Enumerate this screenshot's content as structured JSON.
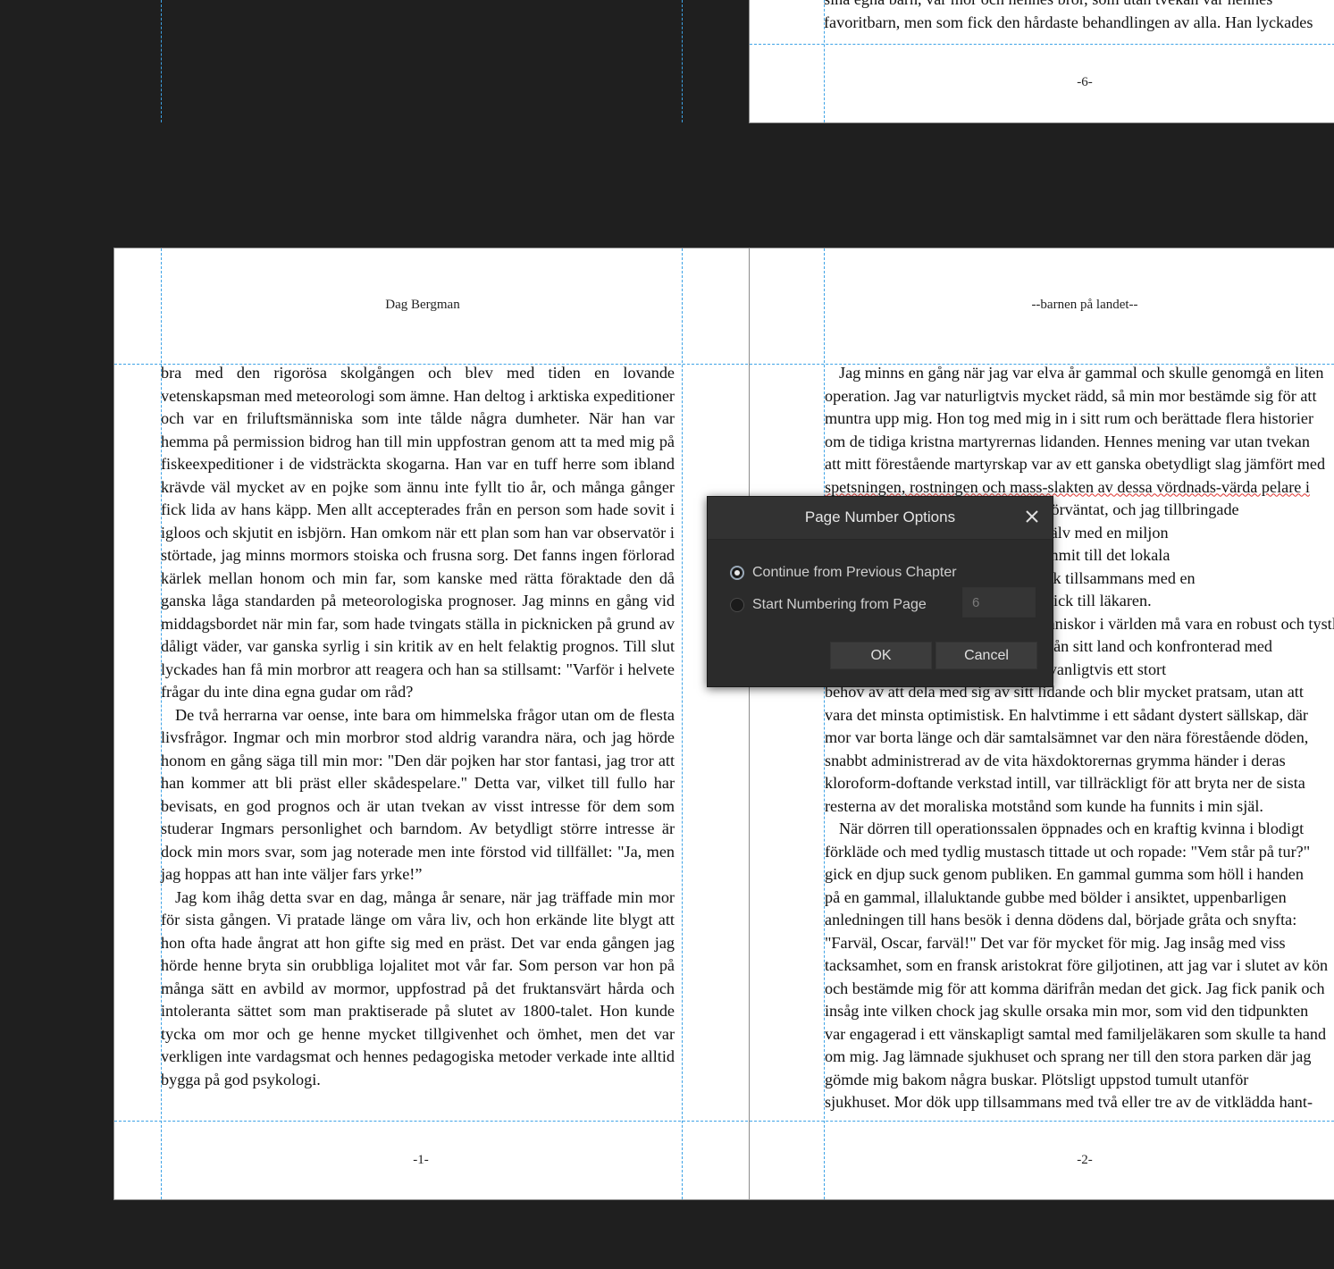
{
  "top_page": {
    "body_lines": [
      "sina egna barn, var mor och hennes bror, som utan tvekan var hennes",
      "favoritbarn, men som fick den hårdaste behandlingen av alla. Han lyckades"
    ],
    "footer": "-6-"
  },
  "left_page": {
    "header": "Dag Bergman",
    "footer": "-1-",
    "paragraphs": [
      "bra med den rigorösa skolgången och blev med tiden en lovande vetenskapsman med meteorologi som ämne. Han deltog i arktiska expeditioner och var en friluftsmänniska som inte tålde några dumheter. När han var hemma på permission bidrog han till min uppfostran genom att ta med mig på fiskeexpeditioner i de vidsträckta skogarna. Han var en tuff herre som ibland krävde väl mycket av en pojke som ännu inte fyllt tio år, och många gånger fick lida av hans käpp. Men allt accepterades från en person som hade sovit i igloos och skjutit en isbjörn. Han omkom när ett plan som han var observatör i störtade, jag minns mormors stoiska och frusna sorg. Det fanns ingen förlorad kärlek mellan honom och min far, som kanske med rätta föraktade den då ganska låga standarden på meteorologiska prognoser. Jag minns en gång vid middagsbordet när min far, som hade tvingats ställa in picknicken på grund av dåligt väder, var ganska syrlig i sin kritik av en helt felaktig prognos. Till slut lyckades han få min morbror att reagera och han sa stillsamt: \"Varför i helvete frågar du inte dina egna gudar om råd?",
      "De två herrarna var oense, inte bara om himmelska frågor utan om de flesta livsfrågor. Ingmar och min morbror stod aldrig varandra nära, och jag hörde honom en gång säga till min mor: \"Den där pojken har stor fantasi, jag tror att han kommer att bli präst eller skådespelare.\" Detta var, vilket till fullo har bevisats, en god prognos och är utan tvekan av visst intresse för dem som studerar Ingmars personlighet och barndom. Av betydligt större intresse är dock min mors svar, som jag noterade men inte förstod vid tillfället: \"Ja, men jag hoppas att han inte väljer fars yrke!”",
      "Jag kom ihåg detta svar en dag, många år senare, när jag träffade min mor för sista gången. Vi pratade länge om våra liv, och hon erkände lite blygt att hon ofta hade ångrat att hon gifte sig med en präst. Det var enda gången jag hörde henne bryta sin orubbliga lojalitet mot vår far. Som person var hon på många sätt en avbild av mormor, uppfostrad på det fruktansvärt hårda och intoleranta sättet som man praktiserade på slutet av 1800-talet. Hon kunde tycka om mor och ge henne mycket tillgivenhet och ömhet, men det var verkligen inte vardagsmat och hennes pedagogiska metoder verkade inte alltid bygga på god psykologi."
    ]
  },
  "right_page": {
    "header": "--barnen på landet--",
    "footer": "-2-",
    "lines": [
      "Jag minns en gång när jag var elva år gammal och skulle genomgå en liten",
      "operation. Jag var naturligtvis mycket rädd, så min mor bestämde sig för att",
      "muntra upp mig. Hon tog med mig in i sitt rum och berättade flera historier",
      "om de tidiga kristna martyrernas lidanden. Hennes mening var utan tvekan",
      "att mitt förestående martyrskap var av ett ganska obetydligt slag jämfört med",
      "spetsningen, rostningen och mass-slakten av dessa vördnads-värda pelare i",
      "kyrkan. Detta fungerade inte som förväntat, och jag tillbringade",
      "morgonen med att associera mig själv med en miljon",
      "martyrer. Till slut, när jag hade kommit till det lokala",
      "sjukhuset, placerades jag på en bänk tillsammans med en",
      "massa andra patienter medan hon gick till läkaren.",
      "Den som förväntar sig att hitta människor i världen må vara en robust och tystlåten",
      "person. När en människa tas bort från sitt land och konfronterad med",
      "alla sorters institutioner, visar han vanligtvis ett stort",
      "behov av att dela med sig av sitt lidande och blir mycket pratsam, utan att",
      "vara det minsta optimistisk. En halvtimme i ett sådant dystert sällskap, där",
      "mor var borta länge och där samtalsämnet var den nära förestående döden,",
      "snabbt administrerad av de vita häxdoktorernas grymma händer i deras",
      "kloroform-doftande verkstad intill, var tillräckligt för att bryta ner de sista",
      "resterna av det moraliska motstånd som kunde ha funnits i min själ.",
      "När dörren till operationssalen öppnades och en kraftig kvinna i blodigt",
      "förkläde och med tydlig mustasch tittade ut och ropade: \"Vem står på tur?\"",
      "gick en djup suck genom publiken. En gammal gumma som höll i handen",
      "på en gammal, illaluktande gubbe med bölder i ansiktet, uppenbarligen",
      "anledningen till hans besök i denna dödens dal, började gråta och snyfta:",
      "\"Farväl, Oscar, farväl!\" Det var för mycket för mig. Jag insåg med viss",
      "tacksamhet, som en fransk aristokrat före giljotinen, att jag var i slutet av kön",
      "och bestämde mig för att komma därifrån medan det gick. Jag fick panik och",
      "insåg inte vilken chock jag skulle orsaka min mor, som vid den tidpunkten",
      "var engagerad i ett vänskapligt samtal med familjeläkaren som skulle ta hand",
      "om mig. Jag lämnade sjukhuset och sprang ner till den stora parken där jag",
      "gömde mig bakom några buskar. Plötsligt uppstod tumult utanför",
      "sjukhuset. Mor dök upp tillsammans med två eller tre av de vitklädda hant-"
    ]
  },
  "dialog": {
    "title": "Page Number Options",
    "option_continue": "Continue from Previous Chapter",
    "option_start": "Start Numbering from Page",
    "start_page_value": "6",
    "ok_label": "OK",
    "cancel_label": "Cancel",
    "selected": "continue"
  }
}
